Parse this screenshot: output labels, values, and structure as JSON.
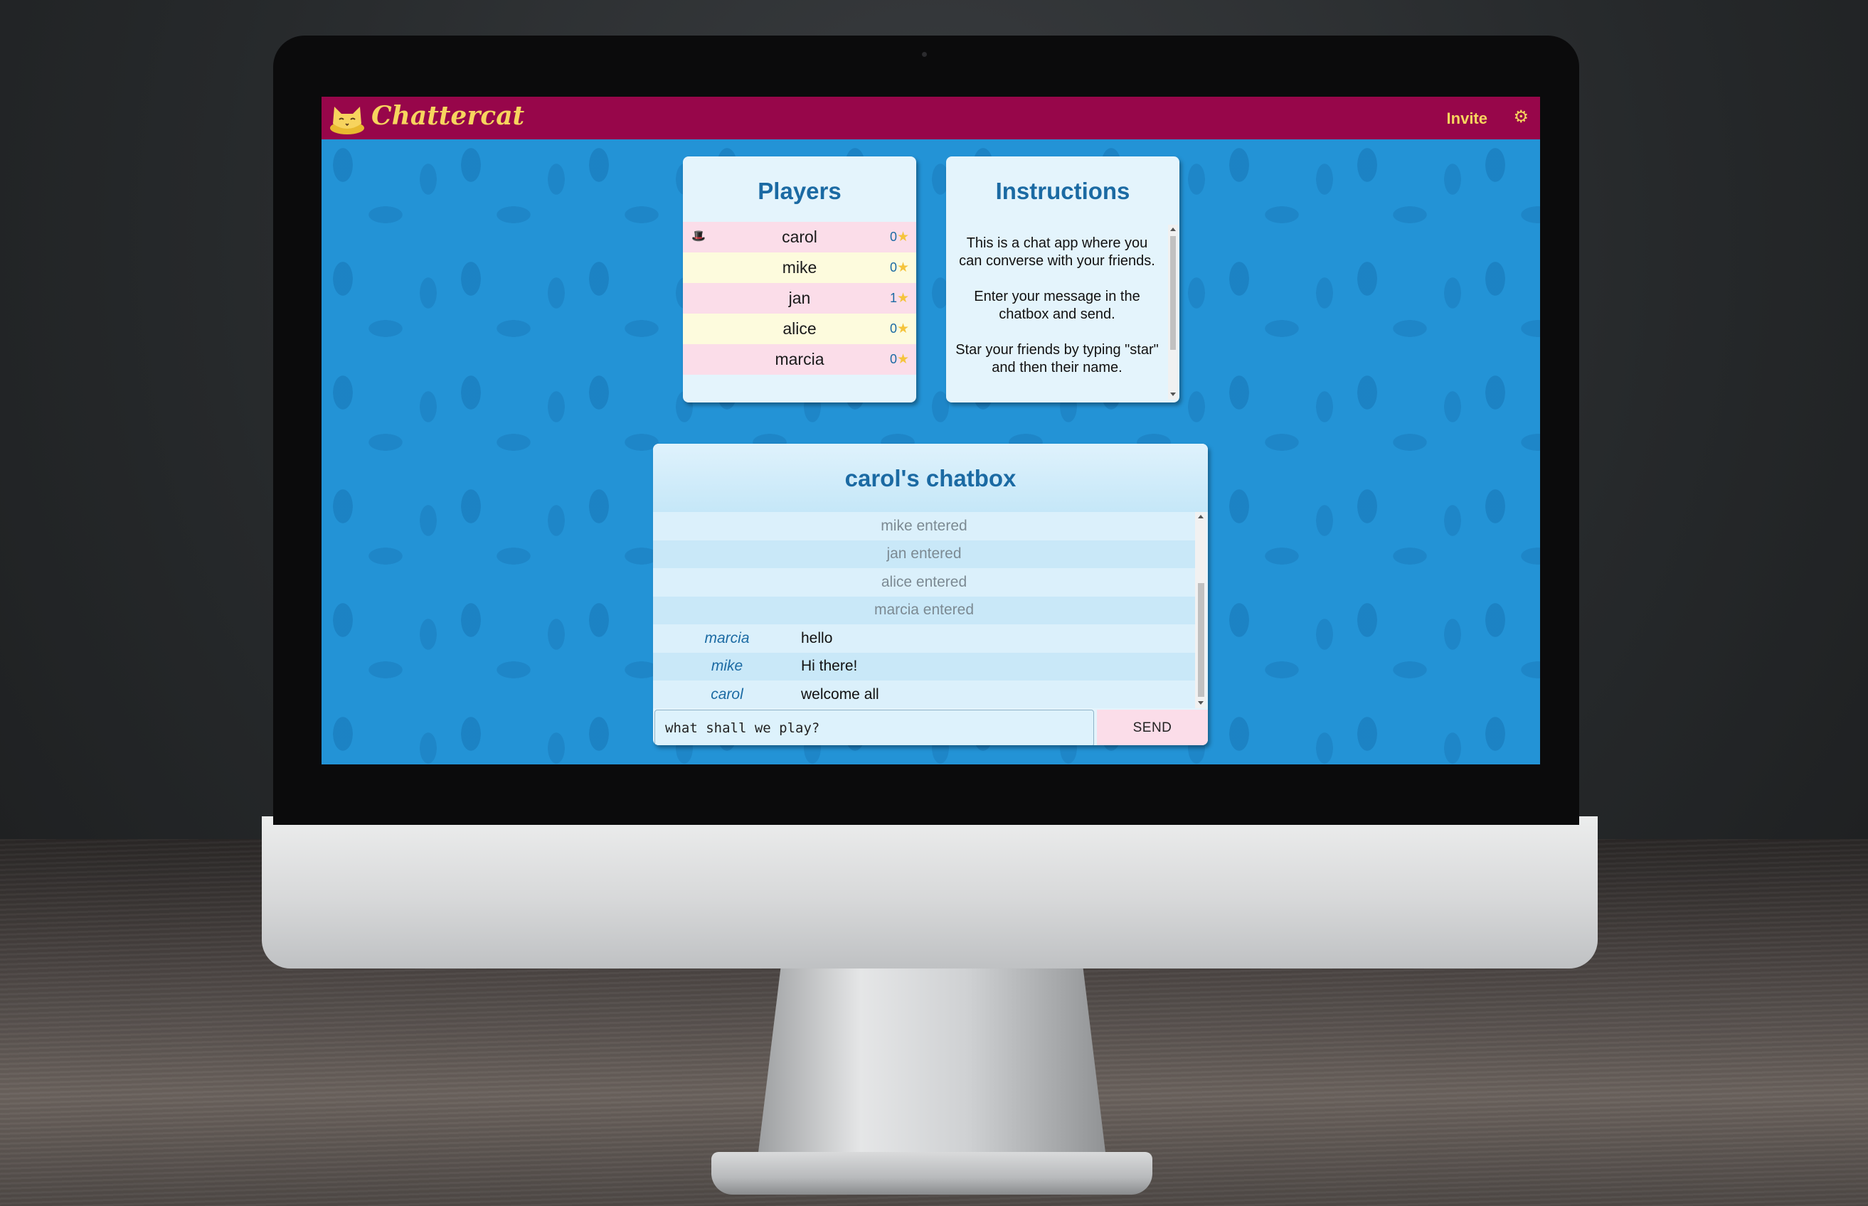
{
  "app": {
    "brand": "Chattercat",
    "invite_label": "Invite",
    "settings_icon": "gear-icon",
    "logo_icon": "cat-icon",
    "colors": {
      "appbar": "#97064a",
      "accent": "#f7d45e",
      "background": "#2393d6",
      "title": "#1b6aa3"
    }
  },
  "players": {
    "title": "Players",
    "list": [
      {
        "name": "carol",
        "score": "0",
        "host": true
      },
      {
        "name": "mike",
        "score": "0",
        "host": false
      },
      {
        "name": "jan",
        "score": "1",
        "host": false
      },
      {
        "name": "alice",
        "score": "0",
        "host": false
      },
      {
        "name": "marcia",
        "score": "0",
        "host": false
      }
    ]
  },
  "instructions": {
    "title": "Instructions",
    "paragraphs": [
      "This is a chat app where you can converse with your friends.",
      "Enter your message in the chatbox and send.",
      "Star your friends by typing \"star\" and then their name."
    ]
  },
  "chatbox": {
    "title": "carol's chatbox",
    "messages": [
      {
        "type": "system",
        "text": "mike entered"
      },
      {
        "type": "system",
        "text": "jan entered"
      },
      {
        "type": "system",
        "text": "alice entered"
      },
      {
        "type": "system",
        "text": "marcia entered"
      },
      {
        "type": "chat",
        "sender": "marcia",
        "text": "hello"
      },
      {
        "type": "chat",
        "sender": "mike",
        "text": "Hi there!"
      },
      {
        "type": "chat",
        "sender": "carol",
        "text": "welcome all"
      }
    ],
    "input_value": "what shall we play?",
    "send_label": "SEND"
  }
}
